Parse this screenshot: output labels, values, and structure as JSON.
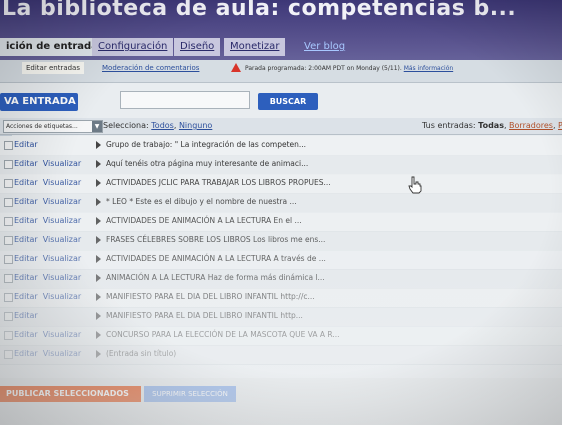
{
  "header": {
    "title": "La biblioteca de aula: competencias b..."
  },
  "tabs": [
    {
      "label": "ición de entradas"
    },
    {
      "label": "Configuración"
    },
    {
      "label": "Diseño"
    },
    {
      "label": "Monetizar"
    },
    {
      "label": "Ver blog"
    }
  ],
  "subtabs": {
    "edit_posts": "Editar entradas",
    "moderate_comments": "Moderación de comentarios",
    "scheduled_notice": "Parada programada: 2:00AM PDT on Monday (5/11).",
    "more_info": "Más información"
  },
  "toolbar": {
    "new_post": "VA ENTRADA",
    "search_value": "",
    "search_button": "BUSCAR"
  },
  "filters": {
    "label_actions": "Acciones de etiquetas...",
    "select_prefix": "Selecciona:",
    "select_all": "Todos",
    "select_none": "Ninguno",
    "your_posts_prefix": "Tus entradas:",
    "your_posts_all": "Todas",
    "your_posts_drafts": "Borradores",
    "your_posts_published": "Pu"
  },
  "actions": {
    "edit": "Editar",
    "view": "Visualizar"
  },
  "posts": [
    {
      "title": "Grupo de trabajo: \" La integración de las competen...",
      "view": false
    },
    {
      "title": "Aquí tenéis otra página muy interesante de animaci...",
      "view": true
    },
    {
      "title": "ACTIVIDADES JCLIC PARA TRABAJAR LOS LIBROS PROPUES...",
      "view": true
    },
    {
      "title": "* LEO * Este es el dibujo y el nombre de nuestra ...",
      "view": true
    },
    {
      "title": "ACTIVIDADES DE ANIMACIÓN A LA LECTURA En el ...",
      "view": true
    },
    {
      "title": "FRASES CÉLEBRES SOBRE LOS LIBROS Los libros me ens...",
      "view": true
    },
    {
      "title": "ACTIVIDADES DE ANIMACIÓN A LA LECTURA A través de ...",
      "view": true
    },
    {
      "title": "ANIMACIÓN A LA LECTURA Haz de forma más dinámica l...",
      "view": true
    },
    {
      "title": "MANIFIESTO PARA EL DIA DEL LIBRO INFANTIL http://c...",
      "view": true
    },
    {
      "title": "MANIFIESTO PARA EL DIA DEL LIBRO INFANTIL http...",
      "view": false
    },
    {
      "title": "CONCURSO PARA LA ELECCIÓN DE LA MASCOTA QUE VA A R...",
      "view": true
    },
    {
      "title": "(Entrada sin título)",
      "view": true
    }
  ],
  "footer": {
    "publish_selected": "PUBLICAR SELECCIONADOS",
    "delete_selected": "SUPRIMIR SELECCIÓN"
  },
  "colors": {
    "header": "#4a4484",
    "primary_button": "#2d5fbd",
    "publish_button": "#e3571f",
    "link": "#2c4f9c"
  }
}
